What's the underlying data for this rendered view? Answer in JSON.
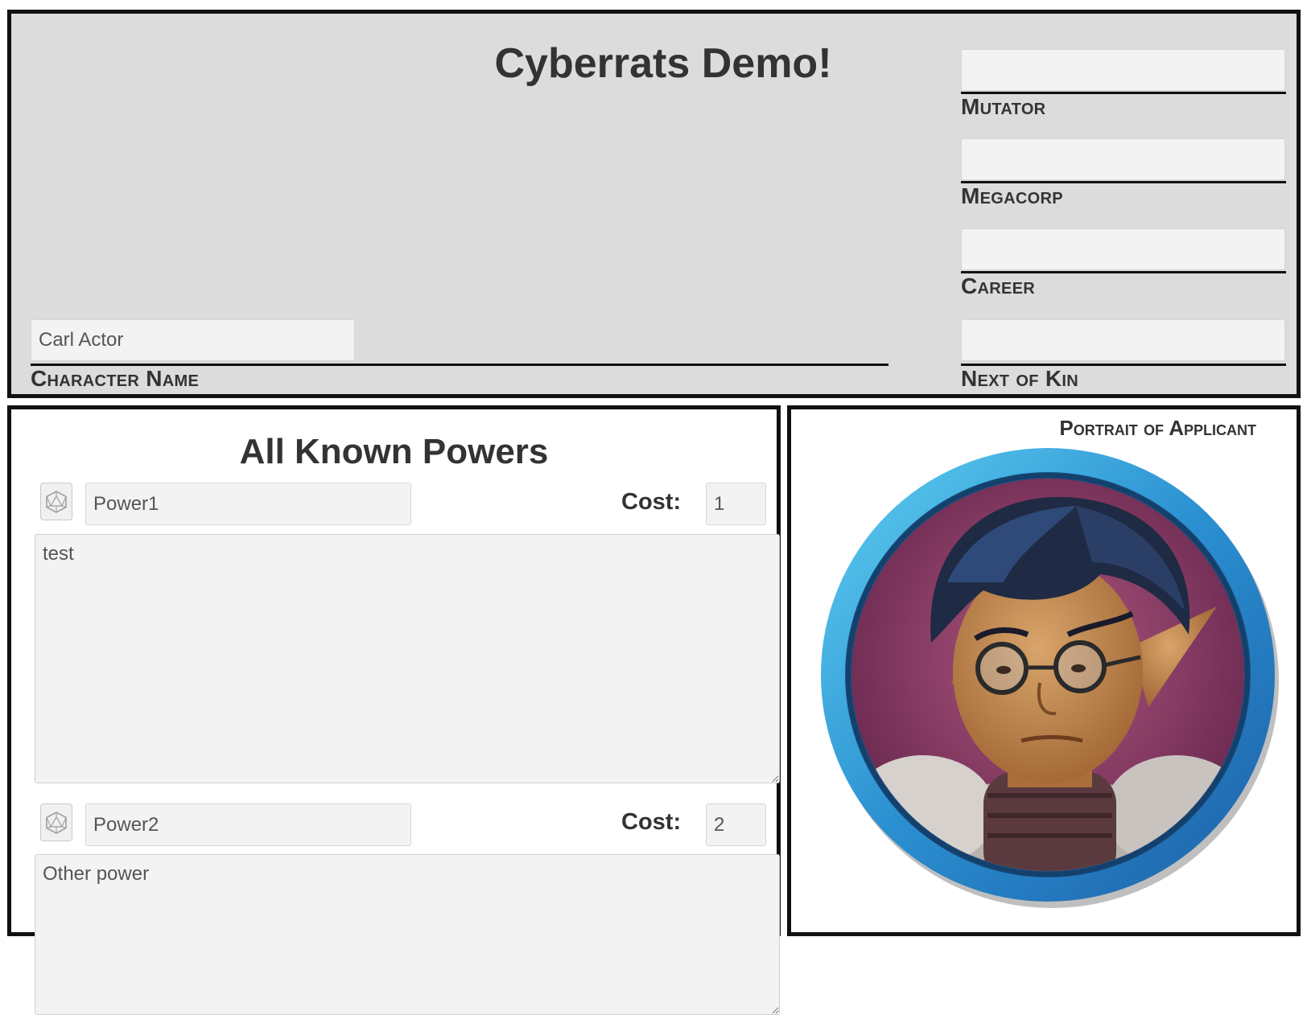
{
  "header": {
    "title": "Cyberrats Demo!",
    "character_name": {
      "value": "Carl Actor",
      "label": "Character Name"
    },
    "mutator": {
      "value": "",
      "label": "Mutator"
    },
    "megacorp": {
      "value": "",
      "label": "Megacorp"
    },
    "career": {
      "value": "",
      "label": "Career"
    },
    "next_of_kin": {
      "value": "",
      "label": "Next of Kin"
    }
  },
  "powers": {
    "title": "All Known Powers",
    "cost_label": "Cost:",
    "items": [
      {
        "name": "Power1",
        "cost": "1",
        "description": "test"
      },
      {
        "name": "Power2",
        "cost": "2",
        "description": "Other power"
      }
    ]
  },
  "portrait": {
    "label": "Portrait of Applicant",
    "icon": "character-portrait-token",
    "frame_color": "#2a8fd0",
    "background_color": "#7a2f62"
  },
  "icons": {
    "roll_button": "d20-die-icon"
  },
  "colors": {
    "header_background": "#dcdcdc",
    "border": "#111111",
    "field_background": "#f3f3f3"
  }
}
